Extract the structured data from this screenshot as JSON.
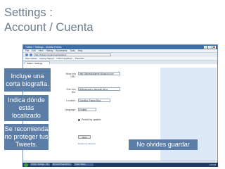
{
  "slide": {
    "title_line1": "Settings :",
    "title_line2": "Account / Cuenta"
  },
  "browser": {
    "window_title": "Twitter / Settings - Mozilla Firefox",
    "menu": [
      "File",
      "Edit",
      "View",
      "History",
      "Bookmarks",
      "Tools",
      "Help"
    ],
    "url": "http://twitter.com/account/settings",
    "bookmarks": [
      "Most Visited",
      "Getting Started",
      "Latest Headlines",
      "PhotoSIC"
    ],
    "tab_label": "Twitter / Settings",
    "status_text": "Done"
  },
  "form": {
    "more_info_label": "More Info URL:",
    "more_info_value": "http://lalmeidafuente.blogspot.com",
    "one_line_bio_label": "One Line Bio:",
    "one_line_bio_value": "Bibliotecaria y docente de la",
    "location_label": "Location:",
    "location_value": "Carolina, Puerto Rico",
    "language_label": "Language:",
    "language_value": "English",
    "protect_label": "Protect my updates",
    "save_button": "Save",
    "delete_link": "Delete my account"
  },
  "taskbar": {
    "items": [
      "Twitter / Settings - Mo...",
      "Microsoft PowerPoint...",
      "Twitter Slides"
    ],
    "clock": "1:23 AM"
  },
  "callouts": {
    "bio_line1": "Incluye una",
    "bio_line2": "corta biografía.",
    "loc_line1": "Indica dónde",
    "loc_line2": "estás",
    "loc_line3": "localizado",
    "protect_line1": "Se recomienda",
    "protect_line2": "no proteger tus",
    "protect_line3": "Tweets.",
    "save": "No olvides guardar"
  }
}
